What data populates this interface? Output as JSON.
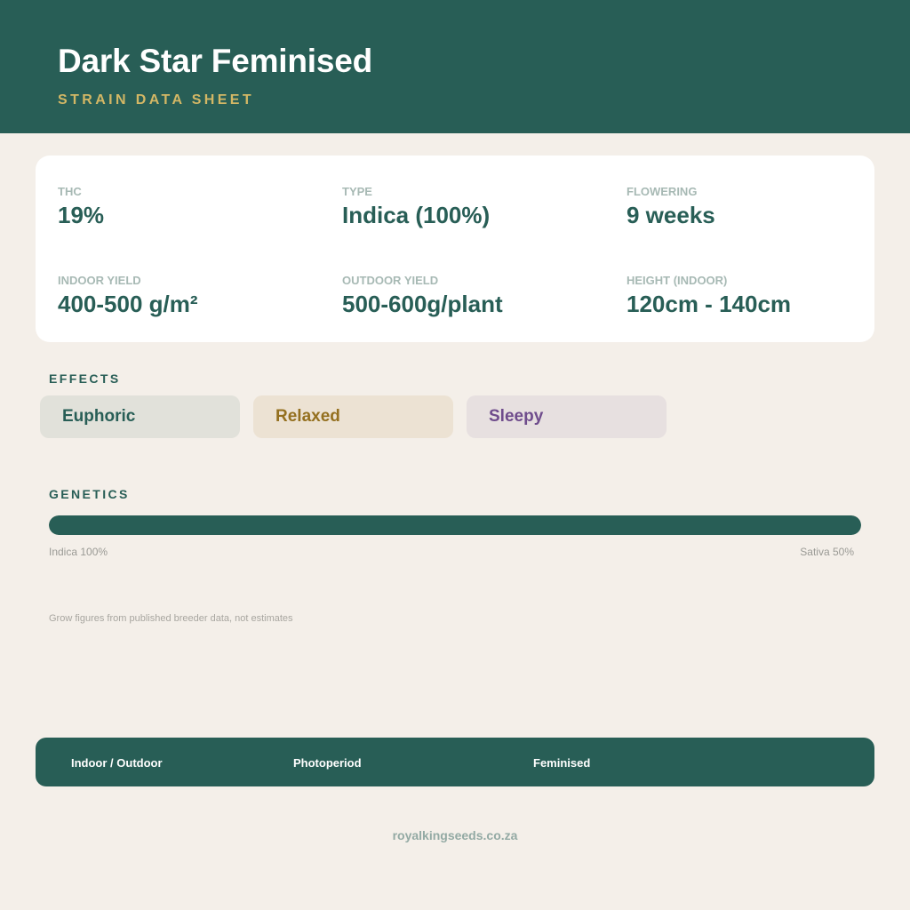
{
  "header": {
    "title": "Dark Star Feminised",
    "subtitle": "STRAIN DATA SHEET"
  },
  "stats": {
    "thc": {
      "label": "THC",
      "value": "19%"
    },
    "type": {
      "label": "TYPE",
      "value": "Indica (100%)"
    },
    "flowering": {
      "label": "FLOWERING",
      "value": "9 weeks"
    },
    "indoor_yield": {
      "label": "INDOOR YIELD",
      "value": "400-500 g/m²"
    },
    "outdoor_yield": {
      "label": "OUTDOOR YIELD",
      "value": "500-600g/plant"
    },
    "height_indoor": {
      "label": "HEIGHT (INDOOR)",
      "value": "120cm - 140cm"
    }
  },
  "effects": {
    "title": "EFFECTS",
    "items": [
      {
        "label": "Euphoric",
        "text_color": "#285e56",
        "bg_color": "#e1e1da"
      },
      {
        "label": "Relaxed",
        "text_color": "#94701f",
        "bg_color": "#ece2d3"
      },
      {
        "label": "Sleepy",
        "text_color": "#6f4c8c",
        "bg_color": "#e7e0e0"
      }
    ]
  },
  "genetics": {
    "title": "GENETICS",
    "indica_percent": 100,
    "indica_label": "Indica 100%",
    "sativa_label": "Sativa 50%"
  },
  "note": "Grow figures from published breeder data, not estimates",
  "footer": {
    "items": [
      "Indoor / Outdoor",
      "Photoperiod",
      "Feminised"
    ]
  },
  "website": "royalkingseeds.co.za",
  "colors": {
    "primary": "#285e56",
    "accent_gold": "#d3b765",
    "background": "#f4efe9",
    "card": "#ffffff"
  }
}
